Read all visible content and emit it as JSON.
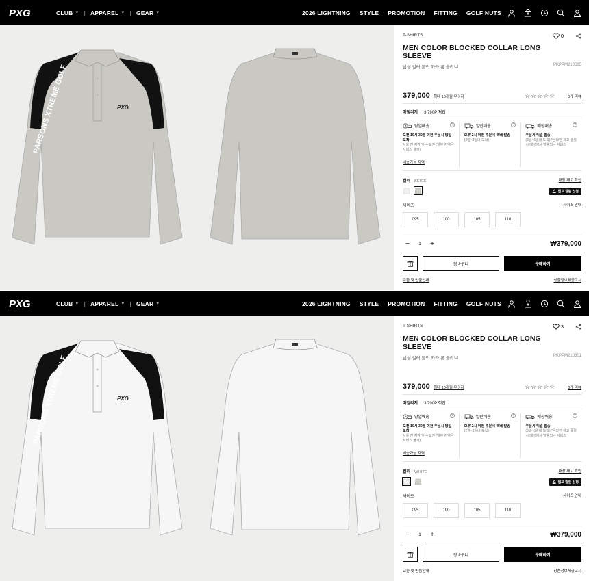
{
  "nav": {
    "logo": "PXG",
    "left_menu": [
      "CLUB",
      "APPAREL",
      "GEAR"
    ],
    "right_menu": [
      "2026 LIGHTNING",
      "STYLE",
      "PROMOTION",
      "FITTING",
      "GOLF NUTS"
    ],
    "icons": [
      "user-icon",
      "bag-icon",
      "recent-icon",
      "search-icon",
      "account-icon"
    ]
  },
  "products": [
    {
      "variant": "beige",
      "shirt_color": "#c9c8c3",
      "category": "T-SHIRTS",
      "likes": "0",
      "title": "MEN COLOR BLOCKED COLLAR LONG SLEEVE",
      "subtitle": "남성 컬러 블럭 카라 롱 슬리브",
      "code": "PKPPM210605",
      "price": "379,000",
      "installment": "최대 10개월 무이자",
      "stars": "☆☆☆☆☆",
      "review_link": "0개 리뷰",
      "mileage_label": "마일리지",
      "mileage_value": "3,790P 적립",
      "shipping": [
        {
          "title": "당일배송",
          "bold": "오전 10시 30분 이전 주문시 당일도착",
          "light": "서울 전 지역 및 수도권 (일부 지역은 서비스 불가)"
        },
        {
          "title": "일반배송",
          "bold": "오후 2시 이전 주문시 택배 발송",
          "light": "(2일~3일내 도착)"
        },
        {
          "title": "매장배송",
          "bold": "주문시 익일 발송",
          "light": "(3일~5일내 도착) *온라인 재고 품절시 매장에서 발송되는 서비스"
        }
      ],
      "ship_link": "배송가능 지역",
      "color_label": "컬러",
      "color_value": "BEIGE",
      "stock_link": "매장 재고 확인",
      "alert_btn": "입고 알림 신청",
      "size_label": "사이즈",
      "size_guide": "사이즈 안내",
      "sizes": [
        "095",
        "100",
        "105",
        "110"
      ],
      "qty": "1",
      "total": "₩379,000",
      "cart_btn": "장바구니",
      "buy_btn": "구매하기",
      "exchange_link": "교환 및 반품안내",
      "info_link": "상품정보제공고시"
    },
    {
      "variant": "white",
      "shirt_color": "#f6f6f6",
      "category": "T-SHIRTS",
      "likes": "3",
      "title": "MEN COLOR BLOCKED COLLAR LONG SLEEVE",
      "subtitle": "남성 컬러 블럭 카라 롱 슬리브",
      "code": "PKPPM210601",
      "price": "379,000",
      "installment": "최대 10개월 무이자",
      "stars": "☆☆☆☆☆",
      "review_link": "0개 리뷰",
      "mileage_label": "마일리지",
      "mileage_value": "3,790P 적립",
      "shipping": [
        {
          "title": "당일배송",
          "bold": "오전 10시 30분 이전 주문시 당일도착",
          "light": "서울 전 지역 및 수도권 (일부 지역은 서비스 불가)"
        },
        {
          "title": "일반배송",
          "bold": "오후 2시 이전 주문시 택배 발송",
          "light": "(2일~3일내 도착)"
        },
        {
          "title": "매장배송",
          "bold": "주문시 익일 발송",
          "light": "(3일~5일내 도착) *온라인 재고 품절시 매장에서 발송되는 서비스"
        }
      ],
      "ship_link": "배송가능 지역",
      "color_label": "컬러",
      "color_value": "WHITE",
      "stock_link": "매장 재고 확인",
      "alert_btn": "입고 알림 신청",
      "size_label": "사이즈",
      "size_guide": "사이즈 안내",
      "sizes": [
        "095",
        "100",
        "105",
        "110"
      ],
      "qty": "1",
      "total": "₩379,000",
      "cart_btn": "장바구니",
      "buy_btn": "구매하기",
      "exchange_link": "교환 및 반품안내",
      "info_link": "상품정보제공고시"
    }
  ],
  "print": {
    "sleeve_text": "PARSONS XTREME GOLF",
    "chest_logo": "PXG"
  }
}
